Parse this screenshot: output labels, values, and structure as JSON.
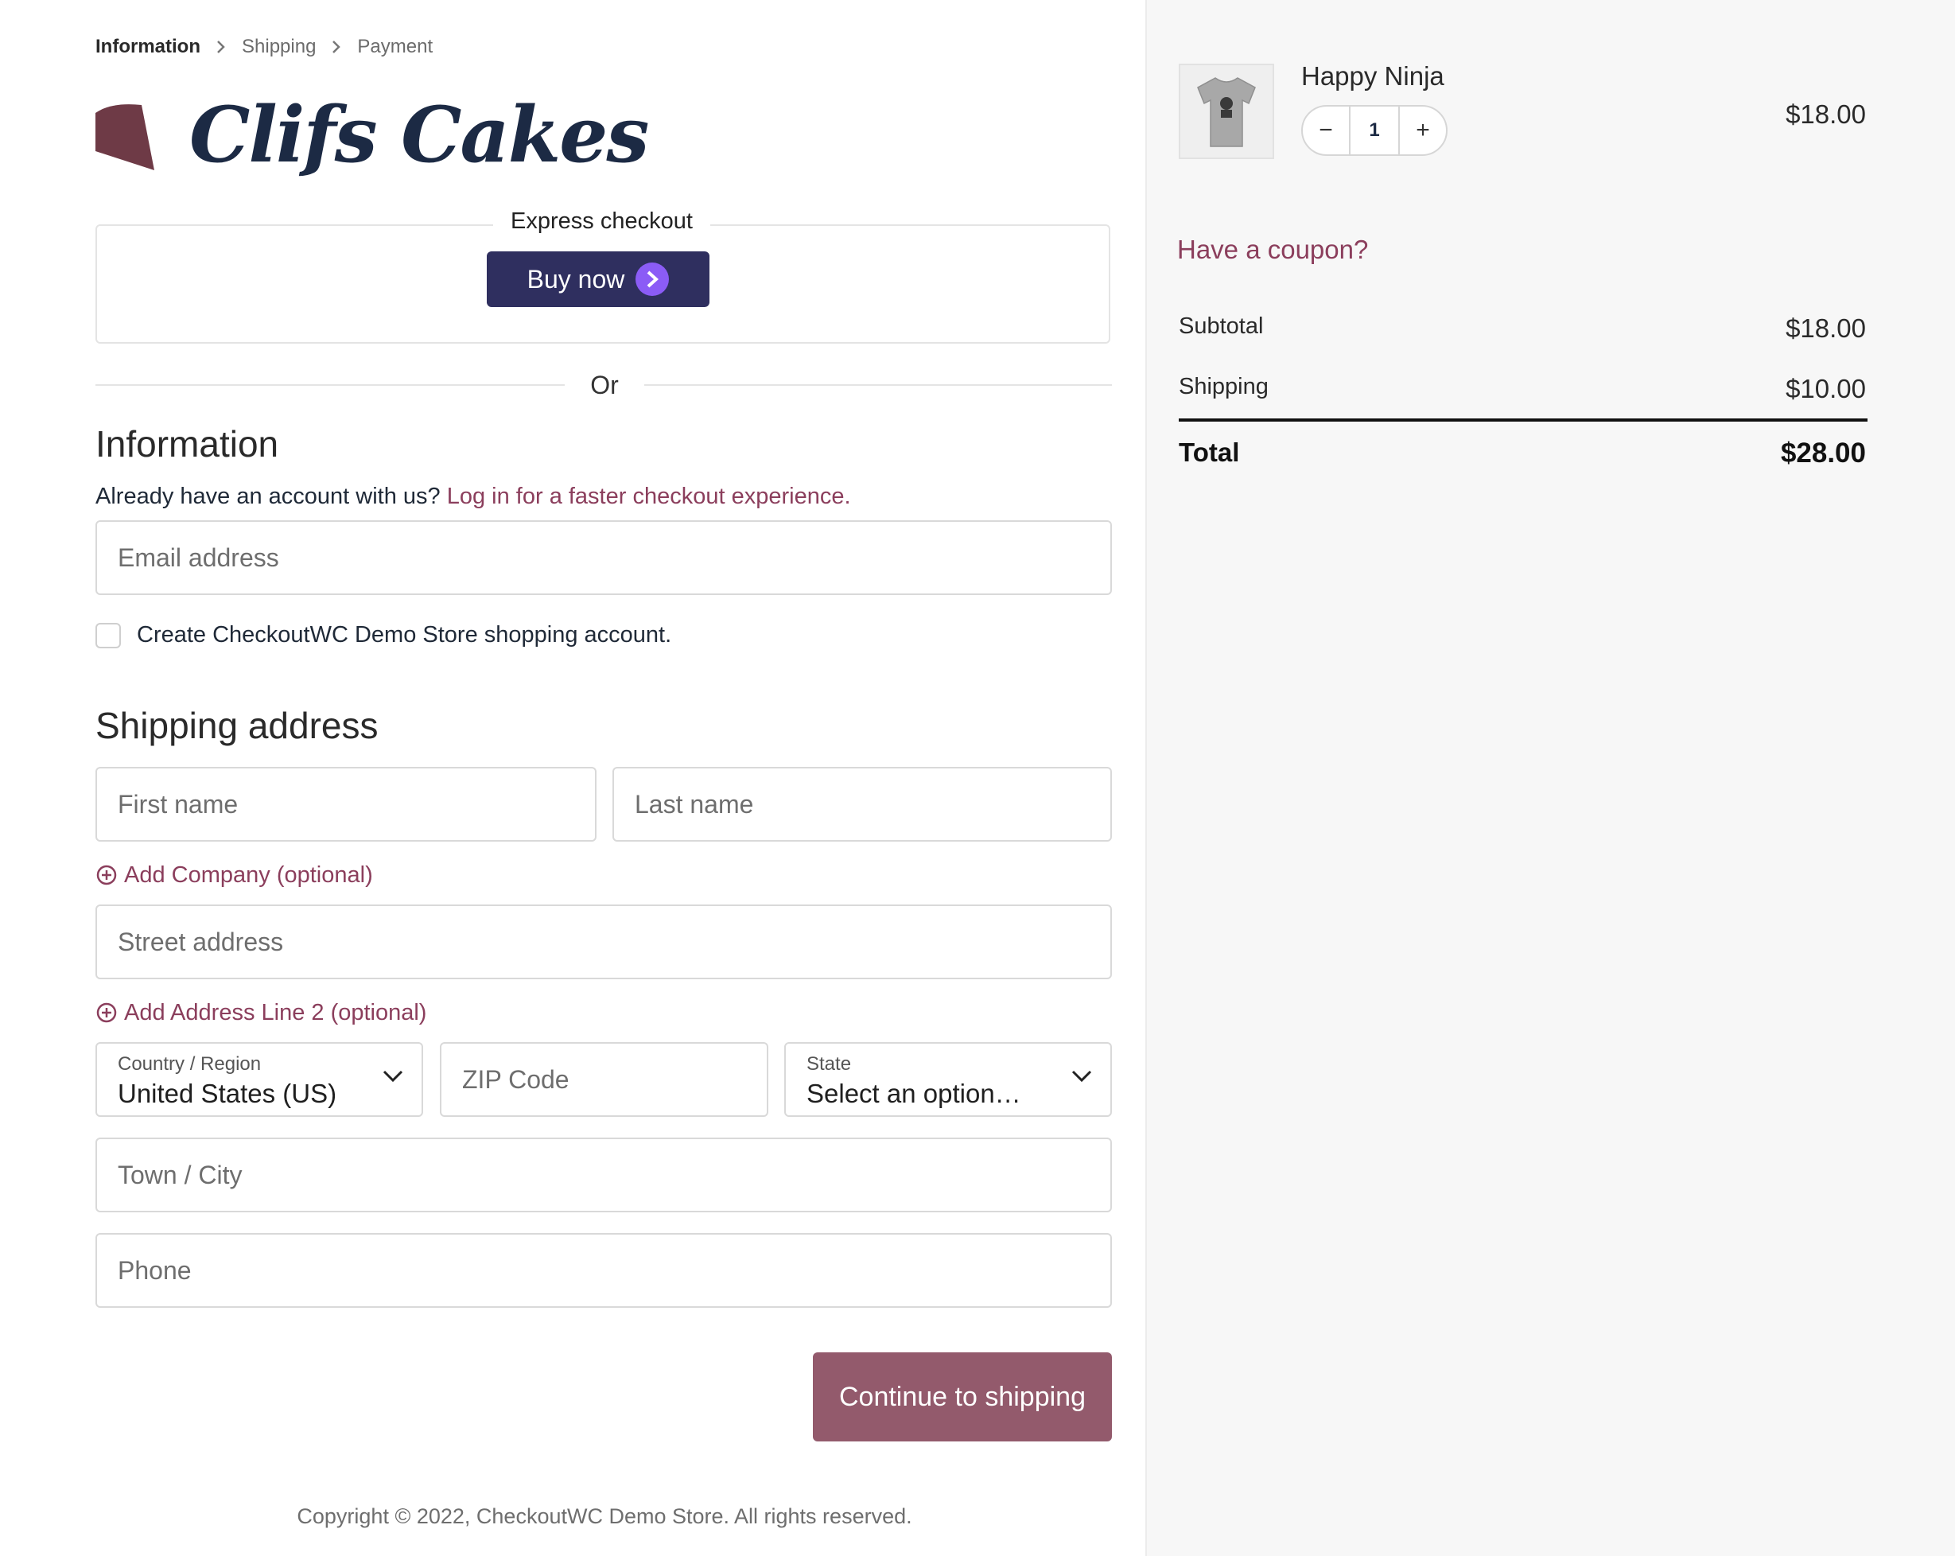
{
  "breadcrumb": {
    "step1": "Information",
    "step2": "Shipping",
    "step3": "Payment"
  },
  "brand": {
    "logo_text": "Clifs Cakes",
    "logo_color": "#6e3a46"
  },
  "express": {
    "title": "Express checkout",
    "buy_now_label": "Buy now"
  },
  "or_text": "Or",
  "information": {
    "heading": "Information",
    "account_prompt": "Already have an account with us?",
    "login_link": "Log in for a faster checkout experience.",
    "email_placeholder": "Email address",
    "create_account_label": "Create CheckoutWC Demo Store shopping account."
  },
  "shipping_address": {
    "heading": "Shipping address",
    "first_name_placeholder": "First name",
    "last_name_placeholder": "Last name",
    "add_company_label": "Add Company (optional)",
    "street_placeholder": "Street address",
    "add_address2_label": "Add Address Line 2 (optional)",
    "country_label": "Country / Region",
    "country_value": "United States (US)",
    "zip_placeholder": "ZIP Code",
    "state_label": "State",
    "state_value": "Select an option…",
    "city_placeholder": "Town / City",
    "phone_placeholder": "Phone"
  },
  "continue_button": "Continue to shipping",
  "copyright": "Copyright © 2022, CheckoutWC Demo Store. All rights reserved.",
  "cart": {
    "product_name": "Happy Ninja",
    "quantity": "1",
    "minus": "−",
    "plus": "+",
    "product_price": "$18.00",
    "coupon_link": "Have a coupon?",
    "subtotal_label": "Subtotal",
    "subtotal_value": "$18.00",
    "shipping_label": "Shipping",
    "shipping_value": "$10.00",
    "total_label": "Total",
    "total_value": "$28.00"
  },
  "colors": {
    "accent": "#8b3e5c",
    "button": "#935a6c",
    "buy_now": "#2f2f5f",
    "sidebar_bg": "#f7f7f7"
  }
}
